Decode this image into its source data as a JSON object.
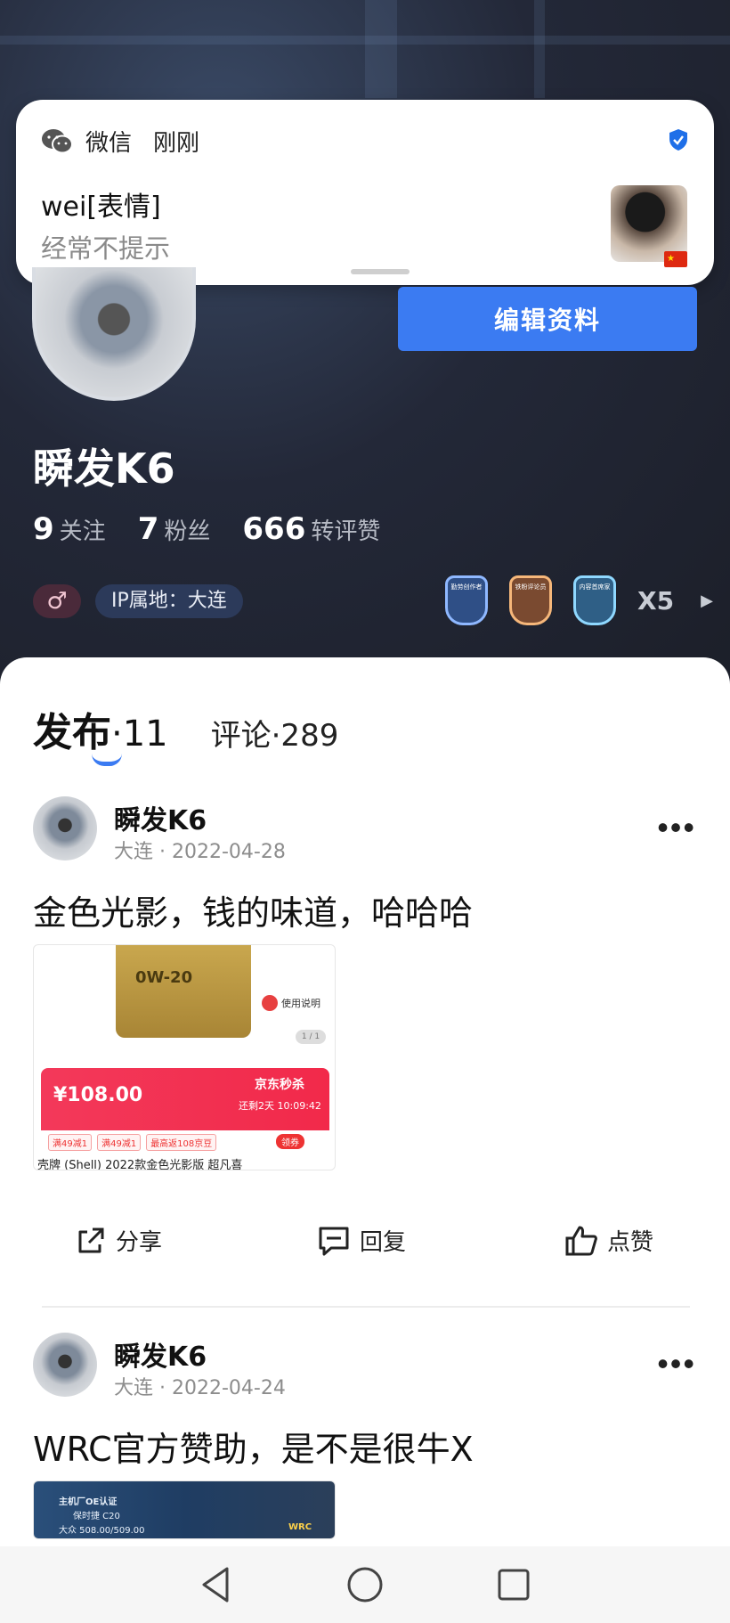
{
  "notification": {
    "app_name": "微信",
    "time": "刚刚",
    "title": "wei[表情]",
    "subtitle": "经常不提示"
  },
  "profile": {
    "edit_button": "编辑资料",
    "username": "瞬发K6",
    "stats": [
      {
        "num": "9",
        "label": "关注"
      },
      {
        "num": "7",
        "label": "粉丝"
      },
      {
        "num": "666",
        "label": "转评赞"
      }
    ],
    "gender_symbol": "♂",
    "ip_label": "IP属地：大连",
    "badges": [
      "勤劳创作者",
      "铁粉评论员",
      "内容首席家"
    ],
    "badge_count": "X5",
    "badge_colors": [
      "#8fb8ff",
      "#f6b77a",
      "#8fd8ff"
    ]
  },
  "tabs": {
    "active_label": "发布",
    "active_count": "·11",
    "other_label": "评论·289"
  },
  "posts": [
    {
      "name": "瞬发K6",
      "meta": "大连 · 2022-04-28",
      "text": "金色光影，钱的味道，哈哈哈",
      "image": {
        "oil_label": "0W-20",
        "usage": "使用说明",
        "pager": "1 / 1",
        "price": "¥108.00",
        "sale": "京东秒杀",
        "timer": "还剩2天 10:09:42",
        "coupons": [
          "满49减1",
          "满49减1",
          "最高返108京豆"
        ],
        "coupon_btn": "领券",
        "product_title": "壳牌 (Shell) 2022款金色光影版 超凡喜"
      }
    },
    {
      "name": "瞬发K6",
      "meta": "大连 · 2022-04-24",
      "text": "WRC官方赞助，是不是很牛X",
      "image": {
        "l1": "主机厂OE认证",
        "l2": "保时捷 C20",
        "l3": "大众 508.00/509.00",
        "l4": "WRC"
      }
    }
  ],
  "actions": {
    "share": "分享",
    "reply": "回复",
    "like": "点赞"
  },
  "accent_color": "#3b7bf2"
}
